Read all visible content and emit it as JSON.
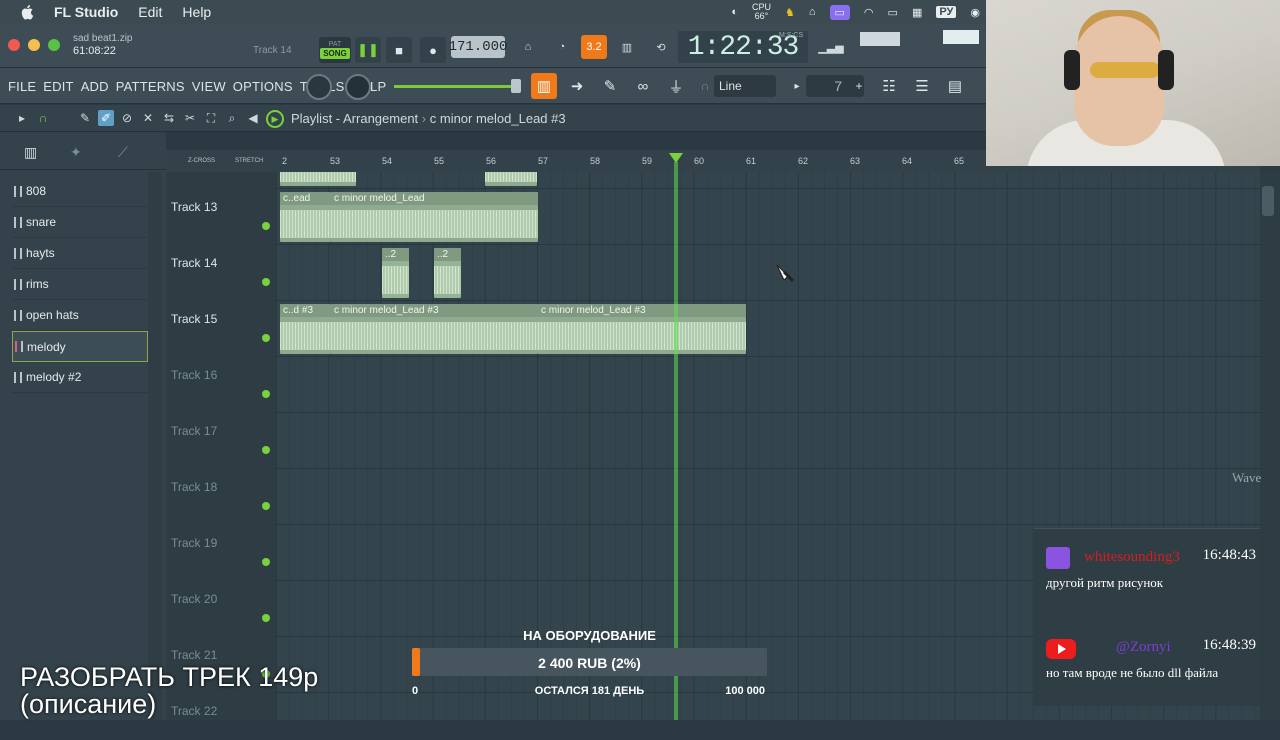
{
  "macos": {
    "app_name": "FL Studio",
    "menu": [
      "Edit",
      "Help"
    ],
    "cpu_label": "CPU",
    "cpu_temp": "66°",
    "input_lang": "РУ"
  },
  "top": {
    "project_name": "sad beat1.zip",
    "project_time": "61:08:22",
    "hint_track": "Track 14",
    "song_label": "SONG",
    "pat_label": "PAT",
    "tempo": "171.000",
    "step": "3.2",
    "time_display": "1:22:33",
    "mscs_label": "M:S:CS"
  },
  "menu": {
    "items": [
      "FILE",
      "EDIT",
      "ADD",
      "PATTERNS",
      "VIEW",
      "OPTIONS",
      "TOOLS",
      "HELP"
    ],
    "snap": "Line",
    "number": "7"
  },
  "playlist": {
    "title": "Playlist - Arrangement",
    "crumb": "c minor melod_Lead #3",
    "zcross": "Z-CROSS",
    "stretch": "STRETCH",
    "ruler": [
      "2",
      "53",
      "54",
      "55",
      "56",
      "57",
      "58",
      "59",
      "60",
      "61",
      "62",
      "63",
      "64",
      "65"
    ]
  },
  "patterns": [
    "808",
    "snare",
    "hayts",
    "rims",
    "open hats",
    "melody",
    "melody #2"
  ],
  "selected_pattern": "melody",
  "tracks": [
    "Track 13",
    "Track 14",
    "Track 15",
    "Track 16",
    "Track 17",
    "Track 18",
    "Track 19",
    "Track 20",
    "Track 21",
    "Track 22"
  ],
  "clips": {
    "t13_a": "c..ead",
    "t13_b": "c minor melod_Lead",
    "t14_a": "..2",
    "t14_b": "..2",
    "t15_a": "c..d #3",
    "t15_b": "c minor melod_Lead #3",
    "t15_c": "c minor melod_Lead #3"
  },
  "overlay": {
    "line1": "РАЗОБРАТЬ ТРЕК 149р",
    "line2": "(описание)",
    "wave_label": "Wave"
  },
  "donation": {
    "title": "НА ОБОРУДОВАНИЕ",
    "amount": "2 400 RUB (2%)",
    "progress": 0.02,
    "min": "0",
    "remaining": "ОСТАЛСЯ 181 ДЕНЬ",
    "max": "100 000"
  },
  "chat": [
    {
      "platform": "twitch",
      "user": "whitesounding3",
      "time": "16:48:43",
      "text": "другой ритм рисунок",
      "color": "#d41f1f"
    },
    {
      "platform": "youtube",
      "user": "@Zornyi",
      "time": "16:48:39",
      "text": "но там вроде не было dll файла",
      "color": "#7a3fd6"
    }
  ],
  "colors": {
    "accent_green": "#79d13c",
    "clip": "#8fab8f",
    "donation_fill": "#f07a1a"
  }
}
